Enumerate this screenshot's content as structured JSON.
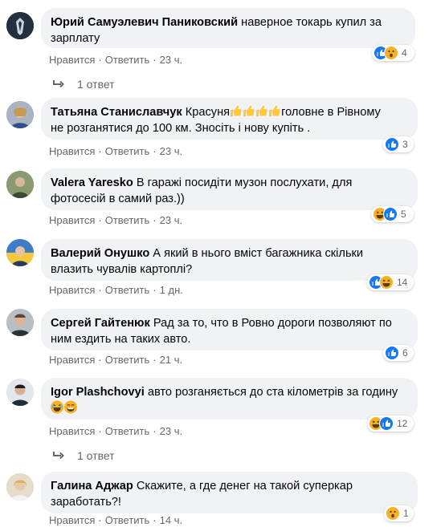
{
  "comments": [
    {
      "author": "Юрий Самуэлевич Паниковский",
      "text_lines": [
        "наверное токарь купил за",
        "зарплату"
      ],
      "like_label": "Нравится",
      "reply_label": "Ответить",
      "time": "23 ч.",
      "reactions": [
        "like-icon",
        "wow-icon"
      ],
      "reaction_count": "4",
      "replies": "1 ответ"
    },
    {
      "author": "Татьяна Станиславчук",
      "text_lines": [
        "Красуня",
        "головне в Рівному",
        "не розганятися до 100 км. Зносіть і нову купіть ."
      ],
      "like_label": "Нравится",
      "reply_label": "Ответить",
      "time": "23 ч.",
      "reactions": [
        "like-icon"
      ],
      "reaction_count": "3"
    },
    {
      "author": "Valera Yaresko",
      "text_lines": [
        "В гаражі посидіти музон послухати, для",
        "фотосесій в самий раз.))"
      ],
      "like_label": "Нравится",
      "reply_label": "Ответить",
      "time": "23 ч.",
      "reactions": [
        "haha-icon",
        "like-icon"
      ],
      "reaction_count": "5"
    },
    {
      "author": "Валерий Онушко",
      "text_lines": [
        "А який в нього вміст багажника скільки",
        "влазить чувалів картоплі?"
      ],
      "like_label": "Нравится",
      "reply_label": "Ответить",
      "time": "1 дн.",
      "reactions": [
        "like-icon",
        "haha-icon"
      ],
      "reaction_count": "14"
    },
    {
      "author": "Сергей Гайтенюк",
      "text_lines": [
        "Рад за то, что в Ровно дороги позволяют по",
        "ним ездить на таких авто."
      ],
      "like_label": "Нравится",
      "reply_label": "Ответить",
      "time": "21 ч.",
      "reactions": [
        "like-icon"
      ],
      "reaction_count": "6"
    },
    {
      "author": "Igor Plashchovyi",
      "text_lines": [
        "авто розганяється до ста кілометрів за годину"
      ],
      "like_label": "Нравится",
      "reply_label": "Ответить",
      "time": "23 ч.",
      "reactions": [
        "haha-icon",
        "like-icon"
      ],
      "reaction_count": "12",
      "replies": "1 ответ"
    },
    {
      "author": "Галина Аджар",
      "text_lines": [
        "Скажите, а где денег на такой суперкар",
        "заработать?!"
      ],
      "like_label": "Нравится",
      "reply_label": "Ответить",
      "time": "14 ч.",
      "reactions": [
        "wow-icon"
      ],
      "reaction_count": "1"
    }
  ],
  "colors": {
    "bubble": "#f0f2f5",
    "meta_text": "#65676b",
    "like_blue": "#1877f2",
    "emoji_yellow": "#f7b125"
  }
}
